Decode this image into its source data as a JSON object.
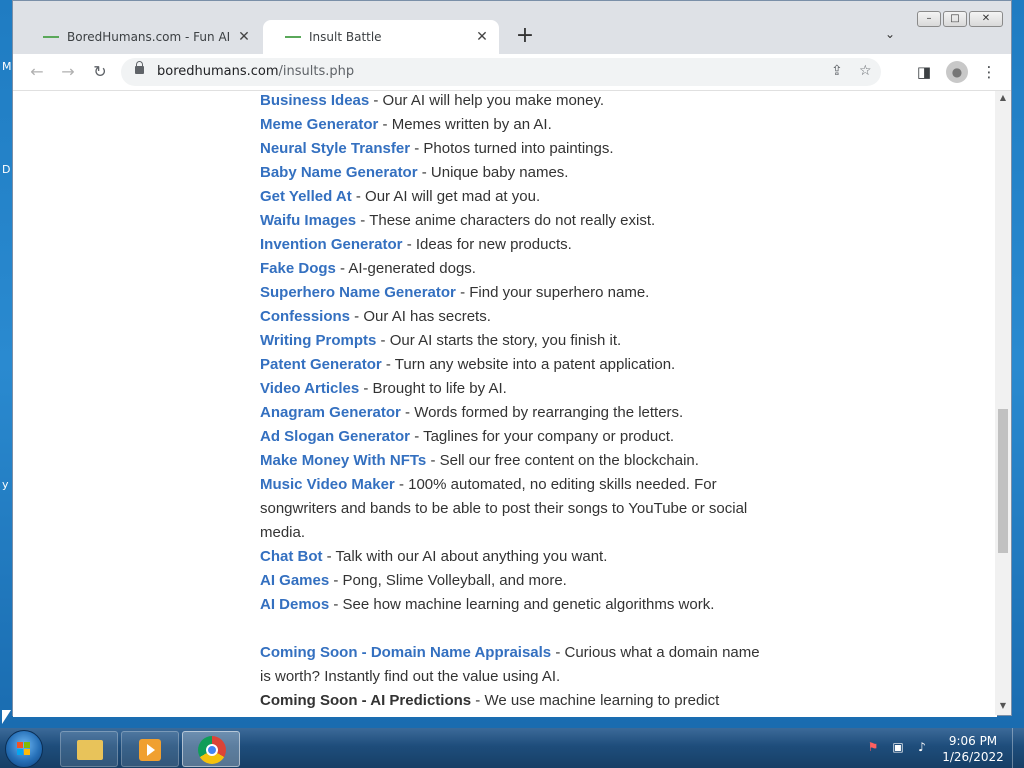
{
  "desktop": {
    "edge_letters": [
      "M",
      "D",
      "y"
    ]
  },
  "browser": {
    "tabs": [
      {
        "title": "BoredHumans.com - Fun AI Prog",
        "active": false
      },
      {
        "title": "Insult Battle",
        "active": true
      }
    ],
    "new_tab_symbol": "+",
    "url_host": "boredhumans.com",
    "url_path": "/insults.php"
  },
  "page": {
    "items": [
      {
        "link": "Business Ideas",
        "desc": " - Our AI will help you make money."
      },
      {
        "link": "Meme Generator",
        "desc": " - Memes written by an AI."
      },
      {
        "link": "Neural Style Transfer",
        "desc": " - Photos turned into paintings."
      },
      {
        "link": "Baby Name Generator",
        "desc": " - Unique baby names."
      },
      {
        "link": "Get Yelled At",
        "desc": " - Our AI will get mad at you."
      },
      {
        "link": "Waifu Images",
        "desc": " - These anime characters do not really exist."
      },
      {
        "link": "Invention Generator",
        "desc": " - Ideas for new products."
      },
      {
        "link": "Fake Dogs",
        "desc": " - AI-generated dogs."
      },
      {
        "link": "Superhero Name Generator",
        "desc": " - Find your superhero name."
      },
      {
        "link": "Confessions",
        "desc": " - Our AI has secrets."
      },
      {
        "link": "Writing Prompts",
        "desc": " - Our AI starts the story, you finish it."
      },
      {
        "link": "Patent Generator",
        "desc": " - Turn any website into a patent application."
      },
      {
        "link": "Video Articles",
        "desc": " - Brought to life by AI."
      },
      {
        "link": "Anagram Generator",
        "desc": " - Words formed by rearranging the letters."
      },
      {
        "link": "Ad Slogan Generator",
        "desc": " - Taglines for your company or product."
      },
      {
        "link": "Make Money With NFTs",
        "desc": " - Sell our free content on the blockchain."
      },
      {
        "link": "Music Video Maker",
        "desc": " - 100% automated, no editing skills needed. For songwriters and bands to be able to post their songs to YouTube or social media."
      },
      {
        "link": "Chat Bot",
        "desc": " - Talk with our AI about anything you want."
      },
      {
        "link": "AI Games",
        "desc": " - Pong, Slime Volleyball, and more."
      },
      {
        "link": "AI Demos",
        "desc": " - See how machine learning and genetic algorithms work."
      }
    ],
    "coming_soon": [
      {
        "label": "Coming Soon - Domain Name Appraisals",
        "desc": " - Curious what a domain name is worth? Instantly find out the value using AI.",
        "is_link": true
      },
      {
        "label": "Coming Soon - AI Predictions",
        "desc": " - We use machine learning to predict",
        "is_link": false
      }
    ]
  },
  "taskbar": {
    "time": "9:06 PM",
    "date": "1/26/2022"
  },
  "colors": {
    "link": "#3470c0",
    "text": "#333333"
  }
}
